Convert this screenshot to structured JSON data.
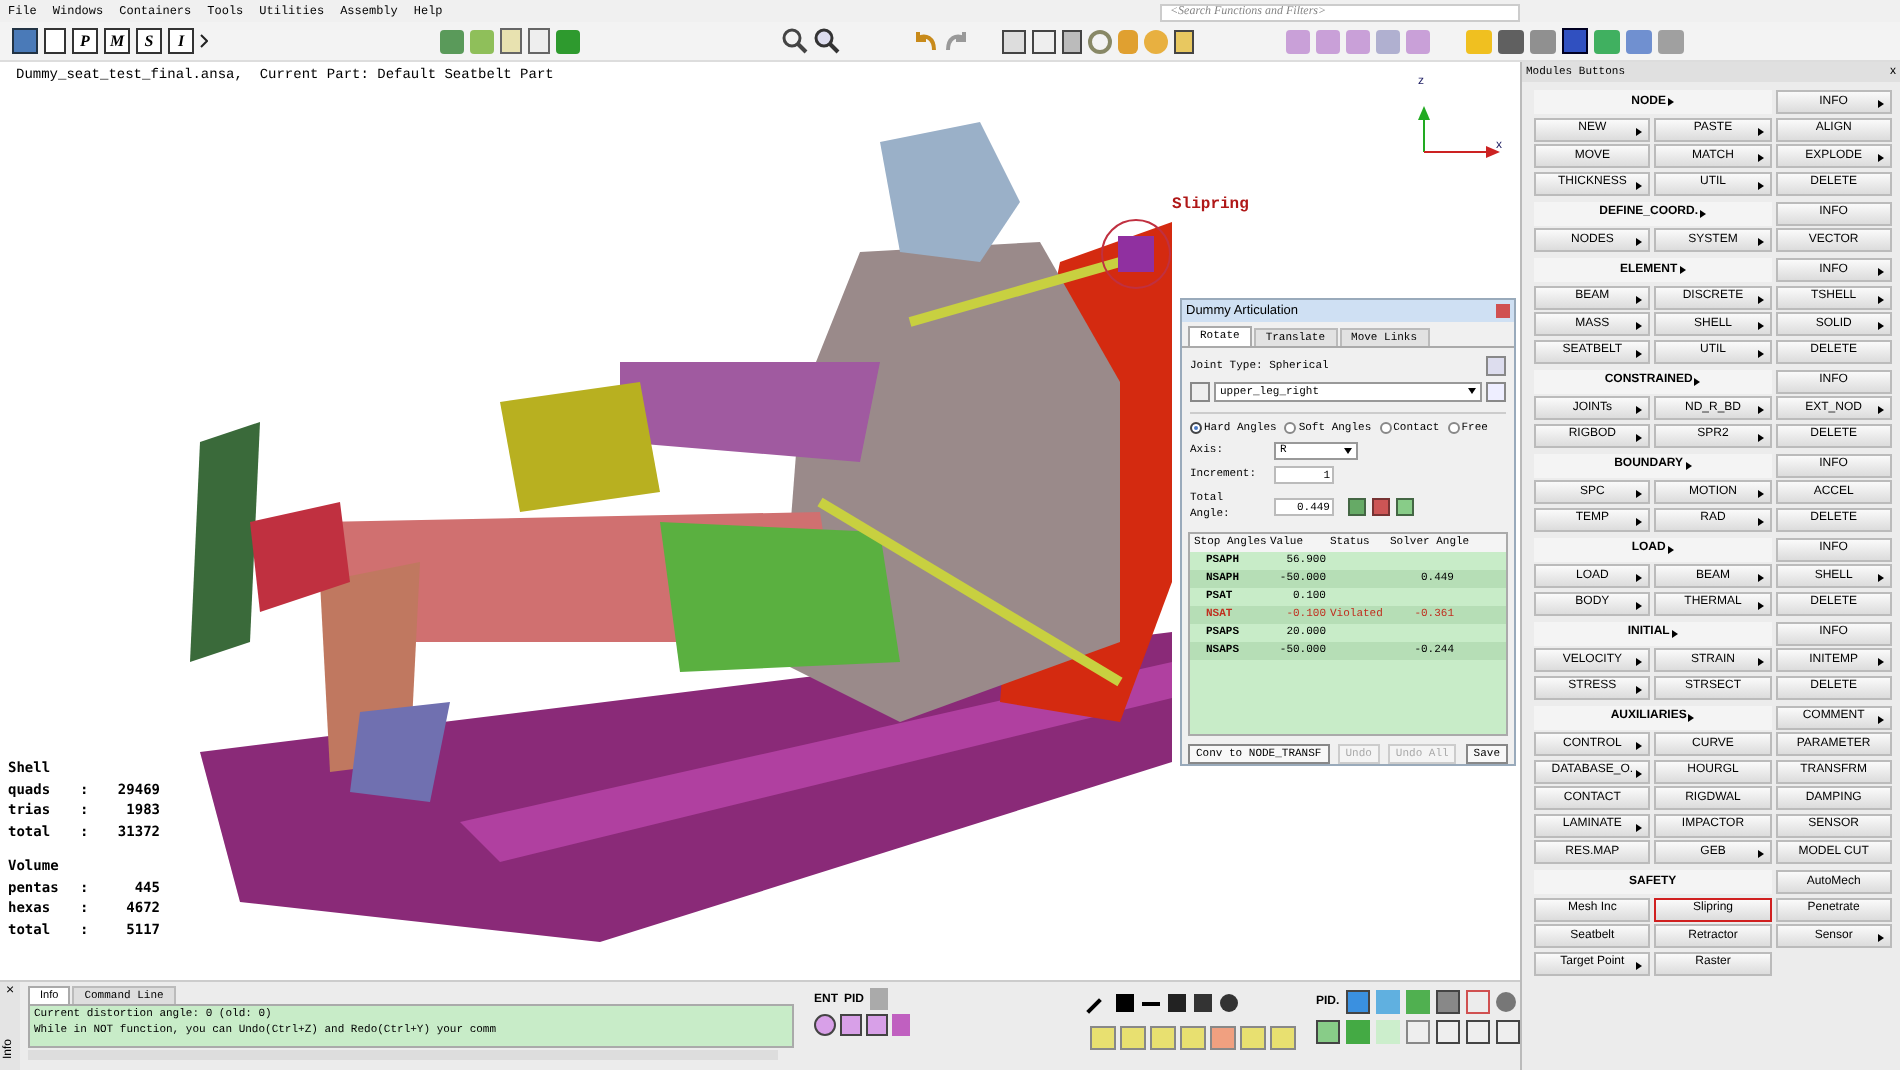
{
  "menu_bar": [
    "File",
    "Windows",
    "Containers",
    "Tools",
    "Utilities",
    "Assembly",
    "Help"
  ],
  "search": {
    "placeholder": "<Search Functions and Filters>"
  },
  "toolbar": {
    "letter_buttons": [
      "P",
      "M",
      "S",
      "I"
    ]
  },
  "viewport": {
    "status_line": "Dummy_seat_test_final.ansa,  Current Part: Default Seatbelt Part",
    "axis_labels": [
      "z",
      "x"
    ],
    "callout": "Slipring",
    "stats": [
      {
        "title": "Shell",
        "rows": [
          [
            "quads",
            ":",
            "29469"
          ],
          [
            "trias",
            ":",
            "1983"
          ],
          [
            "total",
            ":",
            "31372"
          ]
        ]
      },
      {
        "title": "Volume",
        "rows": [
          [
            "pentas",
            ":",
            "445"
          ],
          [
            "hexas",
            ":",
            "4672"
          ],
          [
            "total",
            ":",
            "5117"
          ]
        ]
      }
    ]
  },
  "dialog": {
    "title": "Dummy Articulation",
    "tabs": [
      {
        "label": "Rotate",
        "selected": true
      },
      {
        "label": "Translate",
        "selected": false
      },
      {
        "label": "Move Links",
        "selected": false
      }
    ],
    "joint_type": "Joint Type: Spherical",
    "joint": "upper_leg_right",
    "angle_modes": [
      {
        "label": "Hard Angles",
        "selected": true
      },
      {
        "label": "Soft Angles",
        "selected": false
      },
      {
        "label": "Contact",
        "selected": false
      },
      {
        "label": "Free",
        "selected": false
      }
    ],
    "axis": {
      "label": "Axis:",
      "value": "R"
    },
    "increment": {
      "label": "Increment:",
      "value": "1"
    },
    "total_angle": {
      "label": "Total Angle:",
      "value": "0.449"
    },
    "table": {
      "columns": [
        "Stop Angles",
        "Value",
        "Status",
        "Solver Angle"
      ],
      "rows": [
        {
          "cells": [
            "PSAPH",
            "56.900",
            "",
            ""
          ],
          "violated": false
        },
        {
          "cells": [
            "NSAPH",
            "-50.000",
            "",
            "0.449"
          ],
          "violated": false
        },
        {
          "cells": [
            "PSAT",
            "0.100",
            "",
            ""
          ],
          "violated": false
        },
        {
          "cells": [
            "NSAT",
            "-0.100",
            "Violated",
            "-0.361"
          ],
          "violated": true
        },
        {
          "cells": [
            "PSAPS",
            "20.000",
            "",
            ""
          ],
          "violated": false
        },
        {
          "cells": [
            "NSAPS",
            "-50.000",
            "",
            "-0.244"
          ],
          "violated": false
        }
      ]
    },
    "buttons": [
      {
        "label": "Conv to NODE_TRANSF",
        "disabled": false
      },
      {
        "label": "Undo",
        "disabled": true
      },
      {
        "label": "Undo All",
        "disabled": true
      },
      {
        "label": "Save",
        "disabled": false
      }
    ]
  },
  "modules_panel": {
    "title": "Modules Buttons",
    "close": "x",
    "sections": [
      {
        "title": "NODE",
        "submenu": true,
        "header_button": {
          "label": "INFO",
          "submenu": true
        },
        "rows": [
          [
            {
              "label": "NEW",
              "submenu": true
            },
            {
              "label": "PASTE",
              "submenu": true
            },
            {
              "label": "ALIGN",
              "submenu": false
            }
          ],
          [
            {
              "label": "MOVE",
              "submenu": false
            },
            {
              "label": "MATCH",
              "submenu": true
            },
            {
              "label": "EXPLODE",
              "submenu": true
            }
          ],
          [
            {
              "label": "THICKNESS",
              "submenu": true
            },
            {
              "label": "UTIL",
              "submenu": true
            },
            {
              "label": "DELETE",
              "submenu": false
            }
          ]
        ]
      },
      {
        "title": "DEFINE_COORD.",
        "submenu": true,
        "header_button": {
          "label": "INFO",
          "submenu": false
        },
        "rows": [
          [
            {
              "label": "NODES",
              "submenu": true
            },
            {
              "label": "SYSTEM",
              "submenu": true
            },
            {
              "label": "VECTOR",
              "submenu": false
            }
          ]
        ]
      },
      {
        "title": "ELEMENT",
        "submenu": true,
        "header_button": {
          "label": "INFO",
          "submenu": true
        },
        "rows": [
          [
            {
              "label": "BEAM",
              "submenu": true
            },
            {
              "label": "DISCRETE",
              "submenu": true
            },
            {
              "label": "TSHELL",
              "submenu": true
            }
          ],
          [
            {
              "label": "MASS",
              "submenu": true
            },
            {
              "label": "SHELL",
              "submenu": true
            },
            {
              "label": "SOLID",
              "submenu": true
            }
          ],
          [
            {
              "label": "SEATBELT",
              "submenu": true
            },
            {
              "label": "UTIL",
              "submenu": true
            },
            {
              "label": "DELETE",
              "submenu": false
            }
          ]
        ]
      },
      {
        "title": "CONSTRAINED",
        "submenu": true,
        "header_button": {
          "label": "INFO",
          "submenu": false
        },
        "rows": [
          [
            {
              "label": "JOINTs",
              "submenu": true
            },
            {
              "label": "ND_R_BD",
              "submenu": true
            },
            {
              "label": "EXT_NOD",
              "submenu": true
            }
          ],
          [
            {
              "label": "RIGBOD",
              "submenu": true
            },
            {
              "label": "SPR2",
              "submenu": true
            },
            {
              "label": "DELETE",
              "submenu": false
            }
          ]
        ]
      },
      {
        "title": "BOUNDARY",
        "submenu": true,
        "header_button": {
          "label": "INFO",
          "submenu": false
        },
        "rows": [
          [
            {
              "label": "SPC",
              "submenu": true
            },
            {
              "label": "MOTION",
              "submenu": true
            },
            {
              "label": "ACCEL",
              "submenu": false
            }
          ],
          [
            {
              "label": "TEMP",
              "submenu": true
            },
            {
              "label": "RAD",
              "submenu": true
            },
            {
              "label": "DELETE",
              "submenu": false
            }
          ]
        ]
      },
      {
        "title": "LOAD",
        "submenu": true,
        "header_button": {
          "label": "INFO",
          "submenu": false
        },
        "rows": [
          [
            {
              "label": "LOAD",
              "submenu": true
            },
            {
              "label": "BEAM",
              "submenu": true
            },
            {
              "label": "SHELL",
              "submenu": true
            }
          ],
          [
            {
              "label": "BODY",
              "submenu": true
            },
            {
              "label": "THERMAL",
              "submenu": true
            },
            {
              "label": "DELETE",
              "submenu": false
            }
          ]
        ]
      },
      {
        "title": "INITIAL",
        "submenu": true,
        "header_button": {
          "label": "INFO",
          "submenu": false
        },
        "rows": [
          [
            {
              "label": "VELOCITY",
              "submenu": true
            },
            {
              "label": "STRAIN",
              "submenu": true
            },
            {
              "label": "INITEMP",
              "submenu": true
            }
          ],
          [
            {
              "label": "STRESS",
              "submenu": true
            },
            {
              "label": "STRSECT",
              "submenu": false
            },
            {
              "label": "DELETE",
              "submenu": false
            }
          ]
        ]
      },
      {
        "title": "AUXILIARIES",
        "submenu": true,
        "header_button": {
          "label": "COMMENT",
          "submenu": true
        },
        "rows": [
          [
            {
              "label": "CONTROL",
              "submenu": true
            },
            {
              "label": "CURVE",
              "submenu": false
            },
            {
              "label": "PARAMETER",
              "submenu": false
            }
          ],
          [
            {
              "label": "DATABASE_O.",
              "submenu": true
            },
            {
              "label": "HOURGL",
              "submenu": false
            },
            {
              "label": "TRANSFRM",
              "submenu": false
            }
          ],
          [
            {
              "label": "CONTACT",
              "submenu": false
            },
            {
              "label": "RIGDWAL",
              "submenu": false
            },
            {
              "label": "DAMPING",
              "submenu": false
            }
          ],
          [
            {
              "label": "LAMINATE",
              "submenu": true
            },
            {
              "label": "IMPACTOR",
              "submenu": false
            },
            {
              "label": "SENSOR",
              "submenu": false
            }
          ],
          [
            {
              "label": "RES.MAP",
              "submenu": false
            },
            {
              "label": "GEB",
              "submenu": true
            },
            {
              "label": "MODEL CUT",
              "submenu": false
            }
          ]
        ]
      },
      {
        "title": "SAFETY",
        "submenu": false,
        "header_button": {
          "label": "AutoMech",
          "submenu": false
        },
        "rows": [
          [
            {
              "label": "Mesh Inc",
              "submenu": false
            },
            {
              "label": "Slipring",
              "submenu": false,
              "highlighted": true
            },
            {
              "label": "Penetrate",
              "submenu": false
            }
          ],
          [
            {
              "label": "Seatbelt",
              "submenu": false
            },
            {
              "label": "Retractor",
              "submenu": false
            },
            {
              "label": "Sensor",
              "submenu": true
            }
          ],
          [
            {
              "label": "Target Point",
              "submenu": true
            },
            {
              "label": "Raster",
              "submenu": false
            }
          ]
        ]
      }
    ]
  },
  "info_panel": {
    "side_tab": "Info",
    "close": "×",
    "tabs": [
      {
        "label": "Info",
        "selected": true
      },
      {
        "label": "Command Line",
        "selected": false
      }
    ],
    "lines": [
      "Current distortion angle: 0 (old: 0)",
      "While in NOT function, you can Undo(Ctrl+Z) and Redo(Ctrl+Y) your comm"
    ]
  },
  "bottom_toolbar": {
    "labels": [
      "ENT",
      "PID",
      "PID."
    ]
  }
}
